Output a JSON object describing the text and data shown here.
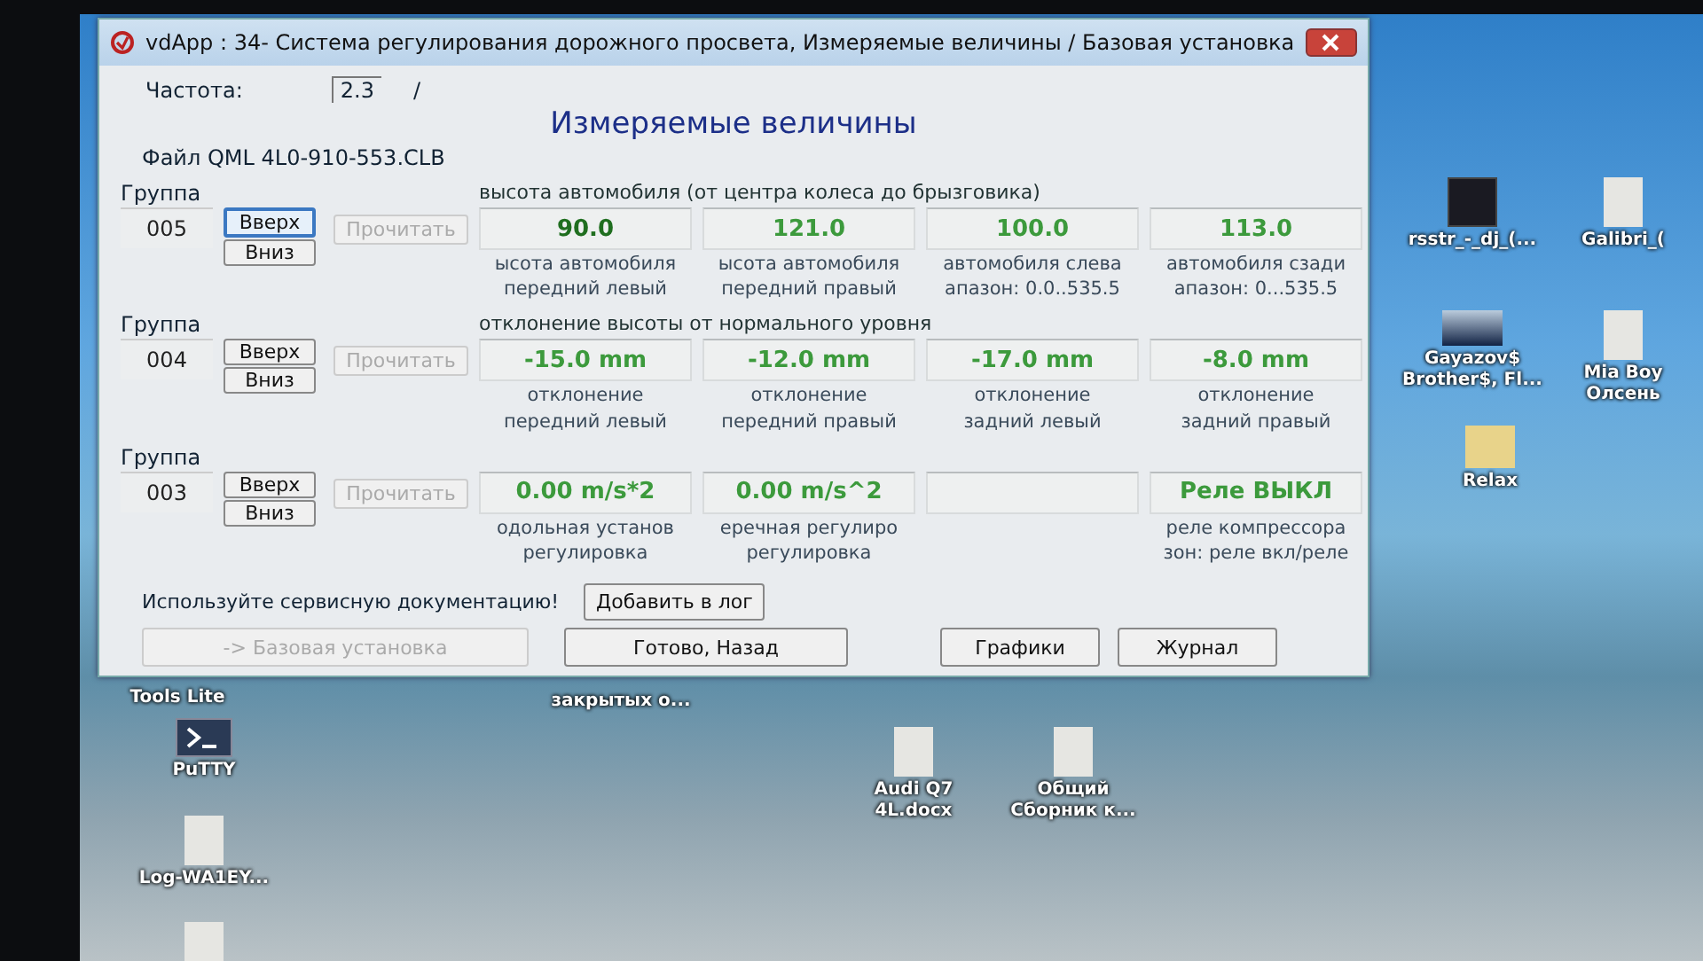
{
  "window": {
    "title": "vdApp : 34- Система регулирования дорожного просвета,  Измеряемые величины / Базовая установка"
  },
  "frequency": {
    "label": "Частота:",
    "value": "2.3",
    "separator": "/"
  },
  "heading": "Измеряемые величины",
  "file": "Файл QML 4L0-910-553.CLB",
  "groups": [
    {
      "label": "Группа",
      "number": "005",
      "up": {
        "label": "Вверх",
        "focused": true
      },
      "down": {
        "label": "Вниз",
        "focused": false
      },
      "read": {
        "label": "Прочитать",
        "disabled": true
      },
      "caption": "высота автомобиля (от центра колеса до брызговика)",
      "fields": [
        {
          "kind": "reading",
          "value": "90.0",
          "description": [
            "ысота автомобиля",
            "передний левый"
          ]
        },
        {
          "kind": "reading",
          "value": "121.0",
          "description": [
            "ысота автомобиля",
            "передний правый"
          ]
        },
        {
          "kind": "reading",
          "value": "100.0",
          "description": [
            "автомобиля слева",
            "апазон: 0.0..535.5"
          ]
        },
        {
          "kind": "reading",
          "value": "113.0",
          "description": [
            "автомобиля сзади",
            "апазон: 0...535.5"
          ]
        }
      ]
    },
    {
      "label": "Группа",
      "number": "004",
      "up": {
        "label": "Вверх",
        "focused": false
      },
      "down": {
        "label": "Вниз",
        "focused": false
      },
      "read": {
        "label": "Прочитать",
        "disabled": true
      },
      "caption": "отклонение высоты от нормального уровня",
      "fields": [
        {
          "kind": "reading",
          "value": "-15.0 mm",
          "description": [
            "отклонение",
            "передний левый"
          ]
        },
        {
          "kind": "reading",
          "value": "-12.0 mm",
          "description": [
            "отклонение",
            "передний правый"
          ]
        },
        {
          "kind": "reading",
          "value": "-17.0 mm",
          "description": [
            "отклонение",
            "задний левый"
          ]
        },
        {
          "kind": "reading",
          "value": "-8.0 mm",
          "description": [
            "отклонение",
            "задний правый"
          ]
        }
      ]
    },
    {
      "label": "Группа",
      "number": "003",
      "up": {
        "label": "Вверх",
        "focused": false
      },
      "down": {
        "label": "Вниз",
        "focused": false
      },
      "read": {
        "label": "Прочитать",
        "disabled": true
      },
      "fields": [
        {
          "kind": "reading",
          "value": "0.00 m/s*2",
          "description": [
            "одольная установ",
            "регулировка"
          ]
        },
        {
          "kind": "reading",
          "value": "0.00 m/s^2",
          "description": [
            "еречная регулиро",
            "регулировка"
          ]
        },
        {
          "kind": "blank"
        },
        {
          "kind": "reading",
          "value": "Реле ВЫКЛ",
          "description": [
            "реле компрессора",
            "зон: реле вкл/реле"
          ]
        }
      ]
    }
  ],
  "notice": "Используйте сервисную документацию!",
  "log_button": {
    "label": "Добавить в лог",
    "disabled": false
  },
  "buttons": [
    {
      "label": "-> Базовая установка",
      "disabled": true
    },
    {
      "label": "Готово, Назад",
      "disabled": false
    },
    {
      "label": "Графики",
      "disabled": false
    },
    {
      "label": "Журнал",
      "disabled": false
    }
  ],
  "desktop_icons": [
    {
      "kind": "app",
      "label": "rsstr_-_dj_(..."
    },
    {
      "kind": "doc",
      "label": "Galibri_("
    },
    {
      "kind": "photo",
      "label": "Gayazov$ Brother$, Fl..."
    },
    {
      "kind": "doc",
      "label": "Mia Boy Олсень"
    },
    {
      "kind": "folder",
      "label": "Relax"
    },
    {
      "kind": "none",
      "label": "Tools Lite"
    },
    {
      "kind": "none",
      "label": "закрытых о..."
    },
    {
      "kind": "terminal",
      "label": "PuTTY"
    },
    {
      "kind": "doc",
      "label": "Log-WA1EY..."
    },
    {
      "kind": "doc",
      "label": "Audi Q7 4L.docx"
    },
    {
      "kind": "doc",
      "label": "Общий Сборник к..."
    },
    {
      "kind": "doc"
    }
  ]
}
